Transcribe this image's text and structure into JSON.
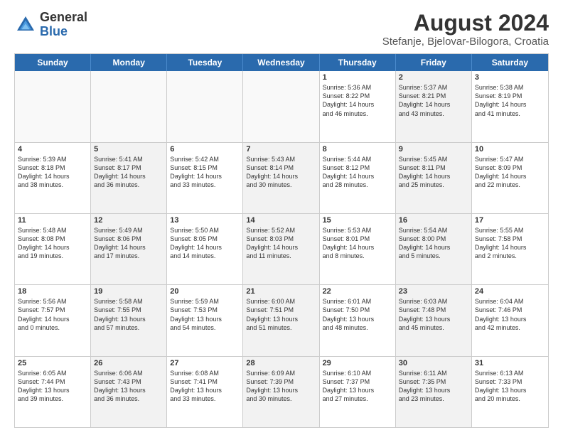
{
  "logo": {
    "general": "General",
    "blue": "Blue"
  },
  "title": "August 2024",
  "subtitle": "Stefanje, Bjelovar-Bilogora, Croatia",
  "header_days": [
    "Sunday",
    "Monday",
    "Tuesday",
    "Wednesday",
    "Thursday",
    "Friday",
    "Saturday"
  ],
  "weeks": [
    [
      {
        "day": "",
        "text": "",
        "shaded": false,
        "empty": true
      },
      {
        "day": "",
        "text": "",
        "shaded": false,
        "empty": true
      },
      {
        "day": "",
        "text": "",
        "shaded": false,
        "empty": true
      },
      {
        "day": "",
        "text": "",
        "shaded": false,
        "empty": true
      },
      {
        "day": "1",
        "text": "Sunrise: 5:36 AM\nSunset: 8:22 PM\nDaylight: 14 hours\nand 46 minutes.",
        "shaded": false,
        "empty": false
      },
      {
        "day": "2",
        "text": "Sunrise: 5:37 AM\nSunset: 8:21 PM\nDaylight: 14 hours\nand 43 minutes.",
        "shaded": true,
        "empty": false
      },
      {
        "day": "3",
        "text": "Sunrise: 5:38 AM\nSunset: 8:19 PM\nDaylight: 14 hours\nand 41 minutes.",
        "shaded": false,
        "empty": false
      }
    ],
    [
      {
        "day": "4",
        "text": "Sunrise: 5:39 AM\nSunset: 8:18 PM\nDaylight: 14 hours\nand 38 minutes.",
        "shaded": false,
        "empty": false
      },
      {
        "day": "5",
        "text": "Sunrise: 5:41 AM\nSunset: 8:17 PM\nDaylight: 14 hours\nand 36 minutes.",
        "shaded": true,
        "empty": false
      },
      {
        "day": "6",
        "text": "Sunrise: 5:42 AM\nSunset: 8:15 PM\nDaylight: 14 hours\nand 33 minutes.",
        "shaded": false,
        "empty": false
      },
      {
        "day": "7",
        "text": "Sunrise: 5:43 AM\nSunset: 8:14 PM\nDaylight: 14 hours\nand 30 minutes.",
        "shaded": true,
        "empty": false
      },
      {
        "day": "8",
        "text": "Sunrise: 5:44 AM\nSunset: 8:12 PM\nDaylight: 14 hours\nand 28 minutes.",
        "shaded": false,
        "empty": false
      },
      {
        "day": "9",
        "text": "Sunrise: 5:45 AM\nSunset: 8:11 PM\nDaylight: 14 hours\nand 25 minutes.",
        "shaded": true,
        "empty": false
      },
      {
        "day": "10",
        "text": "Sunrise: 5:47 AM\nSunset: 8:09 PM\nDaylight: 14 hours\nand 22 minutes.",
        "shaded": false,
        "empty": false
      }
    ],
    [
      {
        "day": "11",
        "text": "Sunrise: 5:48 AM\nSunset: 8:08 PM\nDaylight: 14 hours\nand 19 minutes.",
        "shaded": false,
        "empty": false
      },
      {
        "day": "12",
        "text": "Sunrise: 5:49 AM\nSunset: 8:06 PM\nDaylight: 14 hours\nand 17 minutes.",
        "shaded": true,
        "empty": false
      },
      {
        "day": "13",
        "text": "Sunrise: 5:50 AM\nSunset: 8:05 PM\nDaylight: 14 hours\nand 14 minutes.",
        "shaded": false,
        "empty": false
      },
      {
        "day": "14",
        "text": "Sunrise: 5:52 AM\nSunset: 8:03 PM\nDaylight: 14 hours\nand 11 minutes.",
        "shaded": true,
        "empty": false
      },
      {
        "day": "15",
        "text": "Sunrise: 5:53 AM\nSunset: 8:01 PM\nDaylight: 14 hours\nand 8 minutes.",
        "shaded": false,
        "empty": false
      },
      {
        "day": "16",
        "text": "Sunrise: 5:54 AM\nSunset: 8:00 PM\nDaylight: 14 hours\nand 5 minutes.",
        "shaded": true,
        "empty": false
      },
      {
        "day": "17",
        "text": "Sunrise: 5:55 AM\nSunset: 7:58 PM\nDaylight: 14 hours\nand 2 minutes.",
        "shaded": false,
        "empty": false
      }
    ],
    [
      {
        "day": "18",
        "text": "Sunrise: 5:56 AM\nSunset: 7:57 PM\nDaylight: 14 hours\nand 0 minutes.",
        "shaded": false,
        "empty": false
      },
      {
        "day": "19",
        "text": "Sunrise: 5:58 AM\nSunset: 7:55 PM\nDaylight: 13 hours\nand 57 minutes.",
        "shaded": true,
        "empty": false
      },
      {
        "day": "20",
        "text": "Sunrise: 5:59 AM\nSunset: 7:53 PM\nDaylight: 13 hours\nand 54 minutes.",
        "shaded": false,
        "empty": false
      },
      {
        "day": "21",
        "text": "Sunrise: 6:00 AM\nSunset: 7:51 PM\nDaylight: 13 hours\nand 51 minutes.",
        "shaded": true,
        "empty": false
      },
      {
        "day": "22",
        "text": "Sunrise: 6:01 AM\nSunset: 7:50 PM\nDaylight: 13 hours\nand 48 minutes.",
        "shaded": false,
        "empty": false
      },
      {
        "day": "23",
        "text": "Sunrise: 6:03 AM\nSunset: 7:48 PM\nDaylight: 13 hours\nand 45 minutes.",
        "shaded": true,
        "empty": false
      },
      {
        "day": "24",
        "text": "Sunrise: 6:04 AM\nSunset: 7:46 PM\nDaylight: 13 hours\nand 42 minutes.",
        "shaded": false,
        "empty": false
      }
    ],
    [
      {
        "day": "25",
        "text": "Sunrise: 6:05 AM\nSunset: 7:44 PM\nDaylight: 13 hours\nand 39 minutes.",
        "shaded": false,
        "empty": false
      },
      {
        "day": "26",
        "text": "Sunrise: 6:06 AM\nSunset: 7:43 PM\nDaylight: 13 hours\nand 36 minutes.",
        "shaded": true,
        "empty": false
      },
      {
        "day": "27",
        "text": "Sunrise: 6:08 AM\nSunset: 7:41 PM\nDaylight: 13 hours\nand 33 minutes.",
        "shaded": false,
        "empty": false
      },
      {
        "day": "28",
        "text": "Sunrise: 6:09 AM\nSunset: 7:39 PM\nDaylight: 13 hours\nand 30 minutes.",
        "shaded": true,
        "empty": false
      },
      {
        "day": "29",
        "text": "Sunrise: 6:10 AM\nSunset: 7:37 PM\nDaylight: 13 hours\nand 27 minutes.",
        "shaded": false,
        "empty": false
      },
      {
        "day": "30",
        "text": "Sunrise: 6:11 AM\nSunset: 7:35 PM\nDaylight: 13 hours\nand 23 minutes.",
        "shaded": true,
        "empty": false
      },
      {
        "day": "31",
        "text": "Sunrise: 6:13 AM\nSunset: 7:33 PM\nDaylight: 13 hours\nand 20 minutes.",
        "shaded": false,
        "empty": false
      }
    ]
  ]
}
